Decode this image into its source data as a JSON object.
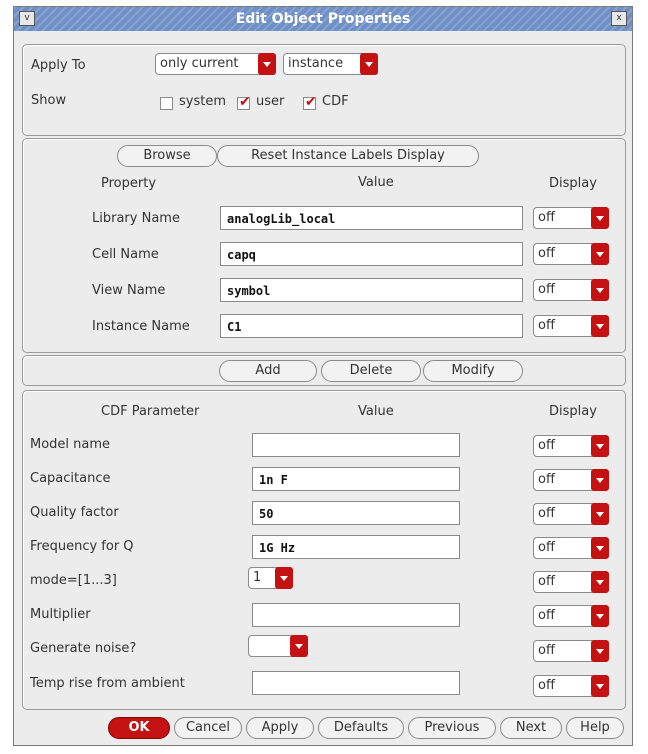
{
  "window": {
    "title": "Edit Object Properties",
    "menu_icon": "v",
    "close_icon": "x"
  },
  "apply": {
    "apply_to_label": "Apply To",
    "apply_to_value": "only current",
    "apply_to_type": "instance",
    "show_label": "Show",
    "checkboxes": [
      {
        "label": "system",
        "checked": false
      },
      {
        "label": "user",
        "checked": true
      },
      {
        "label": "CDF",
        "checked": true
      }
    ]
  },
  "instance_panel": {
    "browse_label": "Browse",
    "reset_label": "Reset Instance Labels Display",
    "headers": {
      "property": "Property",
      "value": "Value",
      "display": "Display"
    },
    "rows": [
      {
        "label": "Library Name",
        "value": "analogLib_local",
        "display": "off"
      },
      {
        "label": "Cell Name",
        "value": "capq",
        "display": "off"
      },
      {
        "label": "View Name",
        "value": "symbol",
        "display": "off"
      },
      {
        "label": "Instance Name",
        "value": "C1",
        "display": "off"
      }
    ]
  },
  "actions": {
    "add": "Add",
    "delete": "Delete",
    "modify": "Modify"
  },
  "cdf_panel": {
    "headers": {
      "param": "CDF Parameter",
      "value": "Value",
      "display": "Display"
    },
    "rows": [
      {
        "label": "Model name",
        "value": "",
        "display": "off"
      },
      {
        "label": "Capacitance",
        "value": "1n F",
        "display": "off"
      },
      {
        "label": "Quality factor",
        "value": "50",
        "display": "off"
      },
      {
        "label": "Frequency for Q",
        "value": "1G Hz",
        "display": "off"
      },
      {
        "label": "mode=[1...3]",
        "value": "1",
        "display": "off"
      },
      {
        "label": "Multiplier",
        "value": "",
        "display": "off"
      },
      {
        "label": "Generate noise?",
        "value": "",
        "display": "off"
      },
      {
        "label": "Temp rise from ambient",
        "value": "",
        "display": "off"
      }
    ]
  },
  "buttons": {
    "ok": "OK",
    "cancel": "Cancel",
    "apply": "Apply",
    "defaults": "Defaults",
    "previous": "Previous",
    "next": "Next",
    "help": "Help"
  },
  "colors": {
    "accent": "#c41212",
    "titlebar": "#6f8fc7",
    "background": "#ececec"
  }
}
